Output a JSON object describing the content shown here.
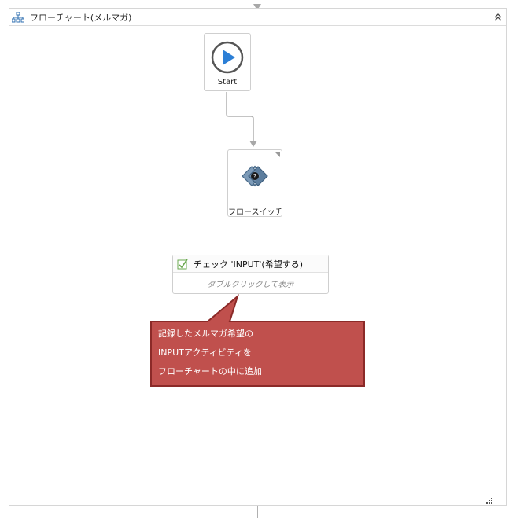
{
  "flowchart": {
    "title": "フローチャート(メルマガ)",
    "icons": {
      "flowchart": "flowchart-icon",
      "collapse": "double-chevron-up-icon",
      "resize": "resize-grip-icon"
    }
  },
  "nodes": {
    "start": {
      "label": "Start",
      "icon": "play-icon"
    },
    "flow_switch": {
      "label": "フロースイッチ",
      "icon": "flow-switch-icon"
    }
  },
  "activity": {
    "title": "チェック 'INPUT'(希望する)",
    "hint": "ダブルクリックして表示",
    "icon": "check-activity-icon"
  },
  "callout": {
    "lines": [
      "記録したメルマガ希望の",
      "INPUTアクティビティを",
      "フローチャートの中に追加"
    ],
    "color": "#c0504d",
    "border": "#8b2a28"
  },
  "colors": {
    "play": "#2c7fd6",
    "switch": "#4a6b8a"
  }
}
